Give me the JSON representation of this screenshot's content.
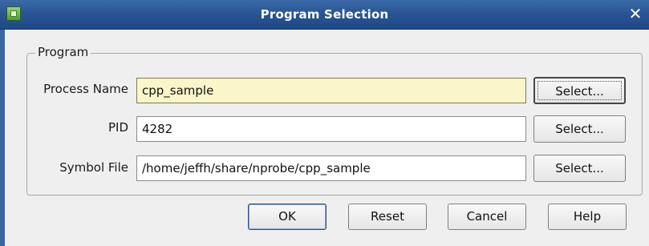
{
  "window": {
    "title": "Program Selection",
    "close_glyph": "✕"
  },
  "group": {
    "title": "Program"
  },
  "rows": [
    {
      "label": "Process Name",
      "value": "cpp_sample",
      "select_label": "Select..."
    },
    {
      "label": "PID",
      "value": "4282",
      "select_label": "Select..."
    },
    {
      "label": "Symbol File",
      "value": "/home/jeffh/share/nprobe/cpp_sample",
      "select_label": "Select..."
    }
  ],
  "buttons": {
    "ok": "OK",
    "reset": "Reset",
    "cancel": "Cancel",
    "help": "Help"
  },
  "icons": {
    "app": "app-icon",
    "close": "close-icon"
  },
  "colors": {
    "titlebar": "#2a5595",
    "focused_field": "#fbf6c9",
    "window_bg": "#efefef"
  }
}
